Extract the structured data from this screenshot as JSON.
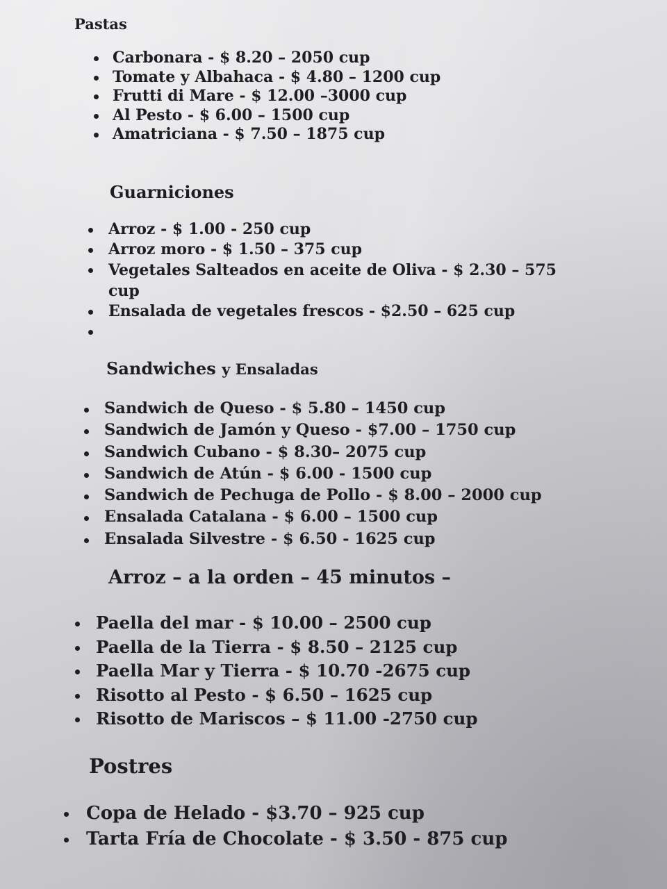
{
  "sections": [
    {
      "title": "Pastas",
      "items": [
        "Carbonara - $ 8.20 – 2050 cup",
        "Tomate y Albahaca - $ 4.80 – 1200 cup",
        "Frutti di Mare - $ 12.00 –3000 cup",
        "Al Pesto - $ 6.00 – 1500 cup",
        "Amatriciana - $ 7.50 – 1875 cup"
      ]
    },
    {
      "title": "Guarniciones",
      "items": [
        "Arroz  - $ 1.00  - 250 cup",
        "Arroz moro - $ 1.50 – 375 cup",
        "Vegetales Salteados en aceite de Oliva - $ 2.30 – 575 cup",
        "Ensalada de vegetales frescos - $2.50 – 625 cup",
        ""
      ]
    },
    {
      "title": "Sandwiches",
      "title_suffix": "y Ensaladas",
      "items": [
        "Sandwich de Queso - $ 5.80 – 1450 cup",
        "Sandwich de Jamón y Queso - $7.00 – 1750 cup",
        "Sandwich Cubano - $ 8.30– 2075 cup",
        "Sandwich de Atún - $ 6.00  - 1500 cup",
        "Sandwich de Pechuga de Pollo - $ 8.00 – 2000 cup",
        "Ensalada Catalana - $ 6.00 – 1500 cup",
        "Ensalada Silvestre - $ 6.50  - 1625 cup"
      ]
    },
    {
      "title": "Arroz – a la orden – 45 minutos –",
      "items": [
        "Paella del mar - $ 10.00 – 2500 cup",
        "Paella de la Tierra - $ 8.50 – 2125 cup",
        "Paella Mar y Tierra - $ 10.70 -2675 cup",
        "Risotto al Pesto - $ 6.50 – 1625 cup",
        "Risotto de Mariscos – $ 11.00 -2750 cup"
      ]
    },
    {
      "title": "Postres",
      "items": [
        "Copa de Helado -  $3.70 – 925 cup",
        "Tarta Fría de Chocolate - $ 3.50  - 875 cup"
      ]
    }
  ]
}
